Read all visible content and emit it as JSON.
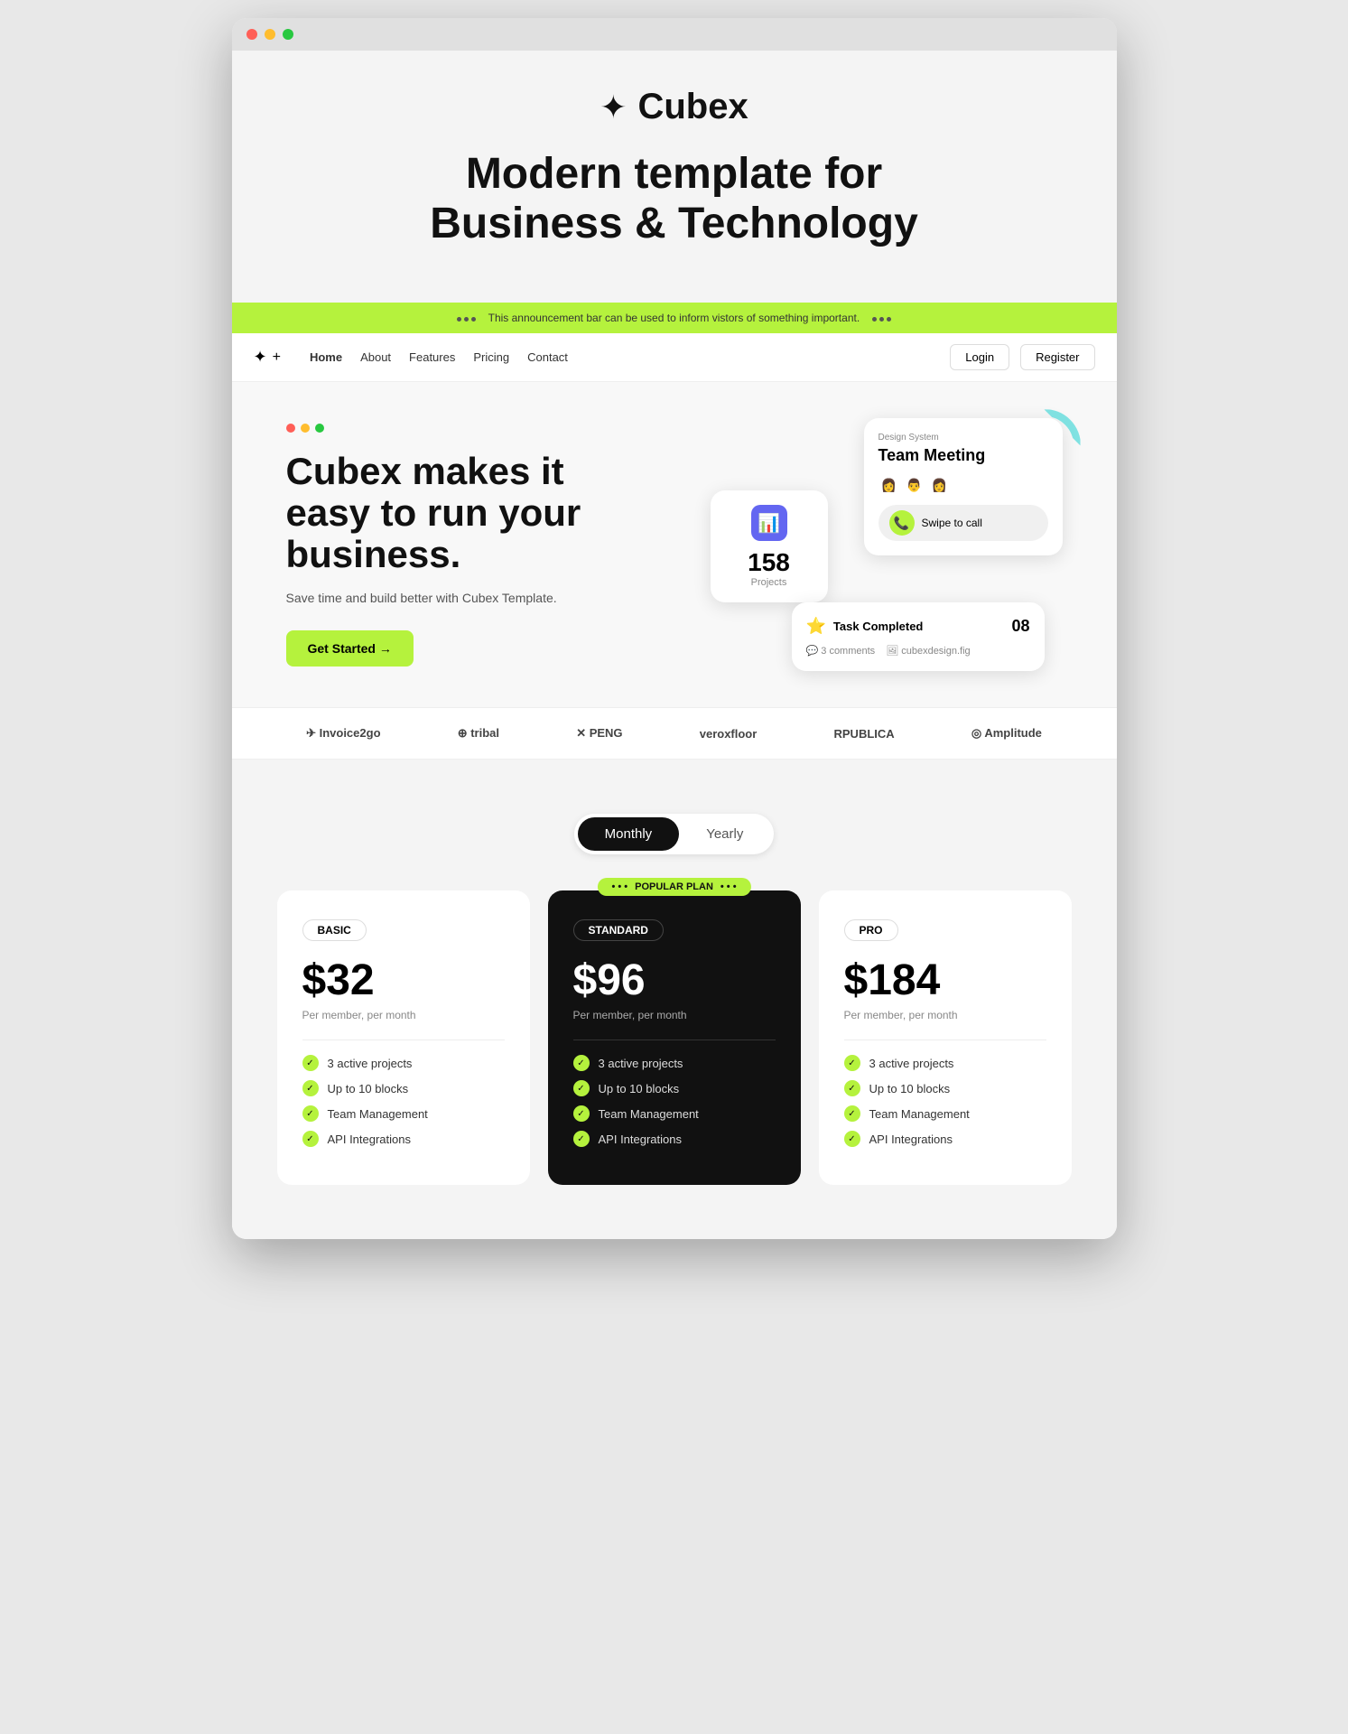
{
  "browser": {
    "dots": [
      "red",
      "yellow",
      "green"
    ]
  },
  "announcement": {
    "text": "This announcement bar can be used to inform vistors of something important."
  },
  "nav": {
    "logo_icon": "✦",
    "logo_text": "",
    "links": [
      "Home",
      "About",
      "Features",
      "Pricing",
      "Contact"
    ],
    "login": "Login",
    "register": "Register"
  },
  "logo": {
    "icon": "✦",
    "text": "Cubex"
  },
  "headline": {
    "line1": "Modern template for",
    "line2": "Business & Technology"
  },
  "hero": {
    "title_line1": "Cubex makes it",
    "title_line2": "easy to run your",
    "title_line3": "business.",
    "subtitle": "Save time and build better with Cubex Template.",
    "cta": "Get Started →",
    "stats_number": "158",
    "stats_label": "Projects",
    "design_system": "Design System",
    "team_meeting": "Team Meeting",
    "swipe_to_call": "Swipe to call",
    "task_label": "Task Completed",
    "task_number": "08",
    "comments": "3 comments",
    "figma": "cubexdesign.fig"
  },
  "partners": [
    {
      "name": "Invoice2go",
      "icon": "✈"
    },
    {
      "name": "tribal",
      "icon": "⊕"
    },
    {
      "name": "XPENG",
      "icon": "✕"
    },
    {
      "name": "veroxfloor",
      "icon": ""
    },
    {
      "name": "RPUBLICA",
      "icon": ""
    },
    {
      "name": "Amplitude",
      "icon": "◎"
    }
  ],
  "pricing": {
    "toggle_monthly": "Monthly",
    "toggle_yearly": "Yearly",
    "popular_label": "POPULAR PLAN",
    "cards": [
      {
        "plan": "BASIC",
        "badge": "BASIC",
        "price": "$32",
        "period": "Per member, per month",
        "features": [
          "3 active projects",
          "Up to 10 blocks",
          "Team Management",
          "API Integrations"
        ]
      },
      {
        "plan": "STANDARD",
        "badge": "STANDARD",
        "price": "$96",
        "period": "Per member, per month",
        "features": [
          "3 active projects",
          "Up to 10 blocks",
          "Team Management",
          "API Integrations"
        ],
        "featured": true
      },
      {
        "plan": "PRO",
        "badge": "PRO",
        "price": "$184",
        "period": "Per member, per month",
        "features": [
          "3 active projects",
          "Up to 10 blocks",
          "Team Management",
          "API Integrations"
        ]
      }
    ]
  }
}
